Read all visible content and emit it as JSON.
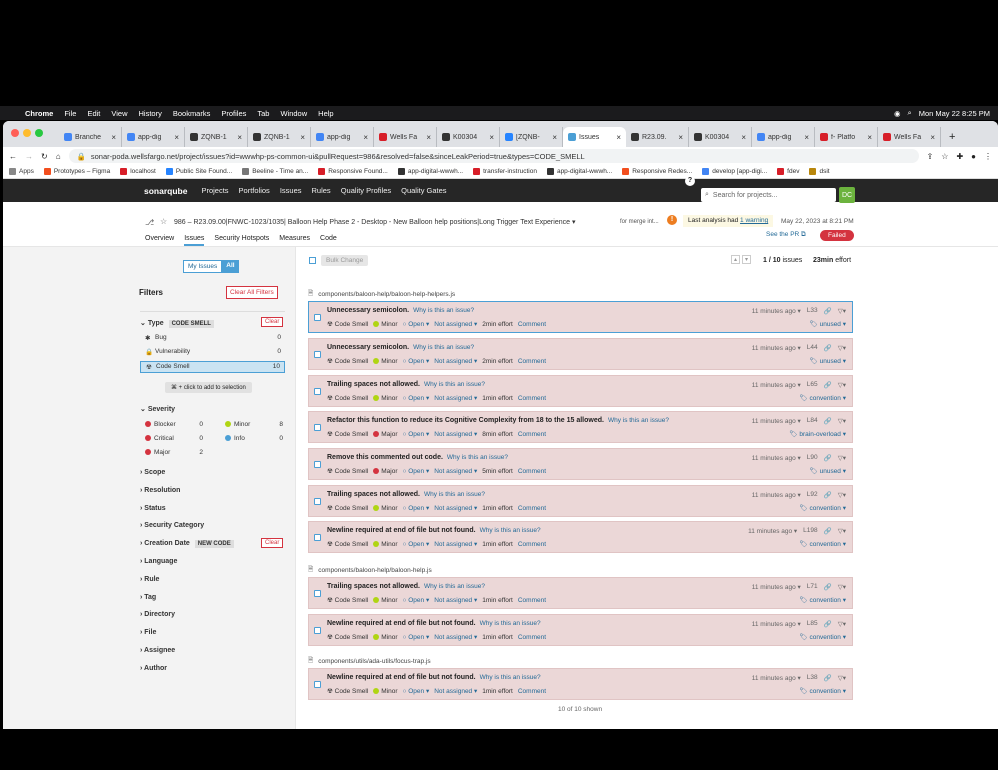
{
  "macos": {
    "apple": "",
    "app": "Chrome",
    "menus": [
      "File",
      "Edit",
      "View",
      "History",
      "Bookmarks",
      "Profiles",
      "Tab",
      "Window",
      "Help"
    ],
    "clock": "Mon May 22  8:25 PM"
  },
  "browser": {
    "tabs": [
      {
        "label": "Branche",
        "color": "#4285f4"
      },
      {
        "label": "app-dig",
        "color": "#4285f4"
      },
      {
        "label": "ZQNB-1",
        "color": "#333"
      },
      {
        "label": "ZQNB-1",
        "color": "#333"
      },
      {
        "label": "app-dig",
        "color": "#4285f4"
      },
      {
        "label": "Wells Fa",
        "color": "#d71e28"
      },
      {
        "label": "K00304",
        "color": "#333"
      },
      {
        "label": "[ZQNB-",
        "color": "#2684ff"
      },
      {
        "label": "Issues",
        "color": "#4b9fd5"
      },
      {
        "label": "R23.09.",
        "color": "#333"
      },
      {
        "label": "K00304",
        "color": "#333"
      },
      {
        "label": "app-dig",
        "color": "#4285f4"
      },
      {
        "label": "f- Platfo",
        "color": "#d71e28"
      },
      {
        "label": "Wells Fa",
        "color": "#d71e28"
      }
    ],
    "new_tab": "+",
    "url": "sonar-poda.wellsfargo.net/project/issues?id=wwwhp-ps-common-ui&pullRequest=986&resolved=false&sinceLeakPeriod=true&types=CODE_SMELL",
    "bookmarks": [
      {
        "label": "Apps",
        "color": "#888"
      },
      {
        "label": "Prototypes – Figma",
        "color": "#f24e1e"
      },
      {
        "label": "localhost",
        "color": "#d71e28"
      },
      {
        "label": "Public Site Found...",
        "color": "#2684ff"
      },
      {
        "label": "Beeline - Time an...",
        "color": "#777"
      },
      {
        "label": "Responsive Found...",
        "color": "#d71e28"
      },
      {
        "label": "app-digital-wwwh...",
        "color": "#333"
      },
      {
        "label": "transfer-instruction",
        "color": "#d71e28"
      },
      {
        "label": "app-digital-wwwh...",
        "color": "#333"
      },
      {
        "label": "Responsive Redes...",
        "color": "#f24e1e"
      },
      {
        "label": "develop [app-digi...",
        "color": "#4285f4"
      },
      {
        "label": "fdev",
        "color": "#d71e28"
      },
      {
        "label": "dsit",
        "color": "#b8860b"
      }
    ]
  },
  "sonar": {
    "logo": "sonarqube",
    "nav": [
      "Projects",
      "Portfolios",
      "Issues",
      "Rules",
      "Quality Profiles",
      "Quality Gates"
    ],
    "search_placeholder": "Search for projects...",
    "avatar": "DC",
    "help": "?"
  },
  "project": {
    "title": "986 – R23.09.00|FNWC-1023/1035| Balloon Help Phase 2 - Desktop - New Balloon help positions|Long Trigger Text Experience",
    "merge": "for merge int...",
    "warning": "Last analysis had ",
    "warning_link": "1 warning",
    "date": "May 22, 2023 at 8:21 PM",
    "pr_link": "See the PR",
    "status": "Failed",
    "tabs": [
      "Overview",
      "Issues",
      "Security Hotspots",
      "Measures",
      "Code"
    ]
  },
  "filters": {
    "my_issues": "My Issues",
    "all": "All",
    "heading": "Filters",
    "clear_all": "Clear All Filters",
    "type_label": "Type",
    "type_value": "CODE SMELL",
    "clear": "Clear",
    "types": [
      {
        "label": "Bug",
        "count": "0"
      },
      {
        "label": "Vulnerability",
        "count": "0"
      },
      {
        "label": "Code Smell",
        "count": "10"
      }
    ],
    "hint": "⌘ + click to add to selection",
    "severity_label": "Severity",
    "severities": [
      {
        "label": "Blocker",
        "count": "0",
        "color": "#d4333f"
      },
      {
        "label": "Minor",
        "count": "8",
        "color": "#b0d513"
      },
      {
        "label": "Critical",
        "count": "0",
        "color": "#d4333f"
      },
      {
        "label": "Info",
        "count": "0",
        "color": "#4b9fd5"
      },
      {
        "label": "Major",
        "count": "2",
        "color": "#d4333f"
      }
    ],
    "creation_date": "Creation Date",
    "new_code": "NEW CODE",
    "sections": [
      "Scope",
      "Resolution",
      "Status",
      "Security Category"
    ],
    "sections2": [
      "Language",
      "Rule",
      "Tag",
      "Directory",
      "File",
      "Assignee",
      "Author"
    ]
  },
  "issues_bar": {
    "bulk": "Bulk Change",
    "count": "1 / 10",
    "count_label": "issues",
    "effort": "23min",
    "effort_label": "effort"
  },
  "files": [
    {
      "path": "components/baloon-help/baloon-help-helpers.js",
      "issues": [
        {
          "msg": "Unnecessary semicolon.",
          "sev": "Minor",
          "sevcolor": "#b0d513",
          "effort": "2min effort",
          "line": "L33",
          "tag": "unused"
        },
        {
          "msg": "Unnecessary semicolon.",
          "sev": "Minor",
          "sevcolor": "#b0d513",
          "effort": "2min effort",
          "line": "L44",
          "tag": "unused"
        },
        {
          "msg": "Trailing spaces not allowed.",
          "sev": "Minor",
          "sevcolor": "#b0d513",
          "effort": "1min effort",
          "line": "L65",
          "tag": "convention"
        },
        {
          "msg": "Refactor this function to reduce its Cognitive Complexity from 18 to the 15 allowed.",
          "sev": "Major",
          "sevcolor": "#d4333f",
          "effort": "8min effort",
          "line": "L84",
          "tag": "brain-overload"
        },
        {
          "msg": "Remove this commented out code.",
          "sev": "Major",
          "sevcolor": "#d4333f",
          "effort": "5min effort",
          "line": "L90",
          "tag": "unused"
        },
        {
          "msg": "Trailing spaces not allowed.",
          "sev": "Minor",
          "sevcolor": "#b0d513",
          "effort": "1min effort",
          "line": "L92",
          "tag": "convention"
        },
        {
          "msg": "Newline required at end of file but not found.",
          "sev": "Minor",
          "sevcolor": "#b0d513",
          "effort": "1min effort",
          "line": "L198",
          "tag": "convention"
        }
      ]
    },
    {
      "path": "components/baloon-help/baloon-help.js",
      "issues": [
        {
          "msg": "Trailing spaces not allowed.",
          "sev": "Minor",
          "sevcolor": "#b0d513",
          "effort": "1min effort",
          "line": "L71",
          "tag": "convention"
        },
        {
          "msg": "Newline required at end of file but not found.",
          "sev": "Minor",
          "sevcolor": "#b0d513",
          "effort": "1min effort",
          "line": "L85",
          "tag": "convention"
        }
      ]
    },
    {
      "path": "components/utils/ada-utils/focus-trap.js",
      "issues": [
        {
          "msg": "Newline required at end of file but not found.",
          "sev": "Minor",
          "sevcolor": "#b0d513",
          "effort": "1min effort",
          "line": "L38",
          "tag": "convention"
        }
      ]
    }
  ],
  "issue_common": {
    "why": "Why is this an issue?",
    "type": "Code Smell",
    "status": "Open",
    "assignee": "Not assigned",
    "comment": "Comment",
    "time": "11 minutes ago"
  },
  "footer": "10 of 10 shown"
}
